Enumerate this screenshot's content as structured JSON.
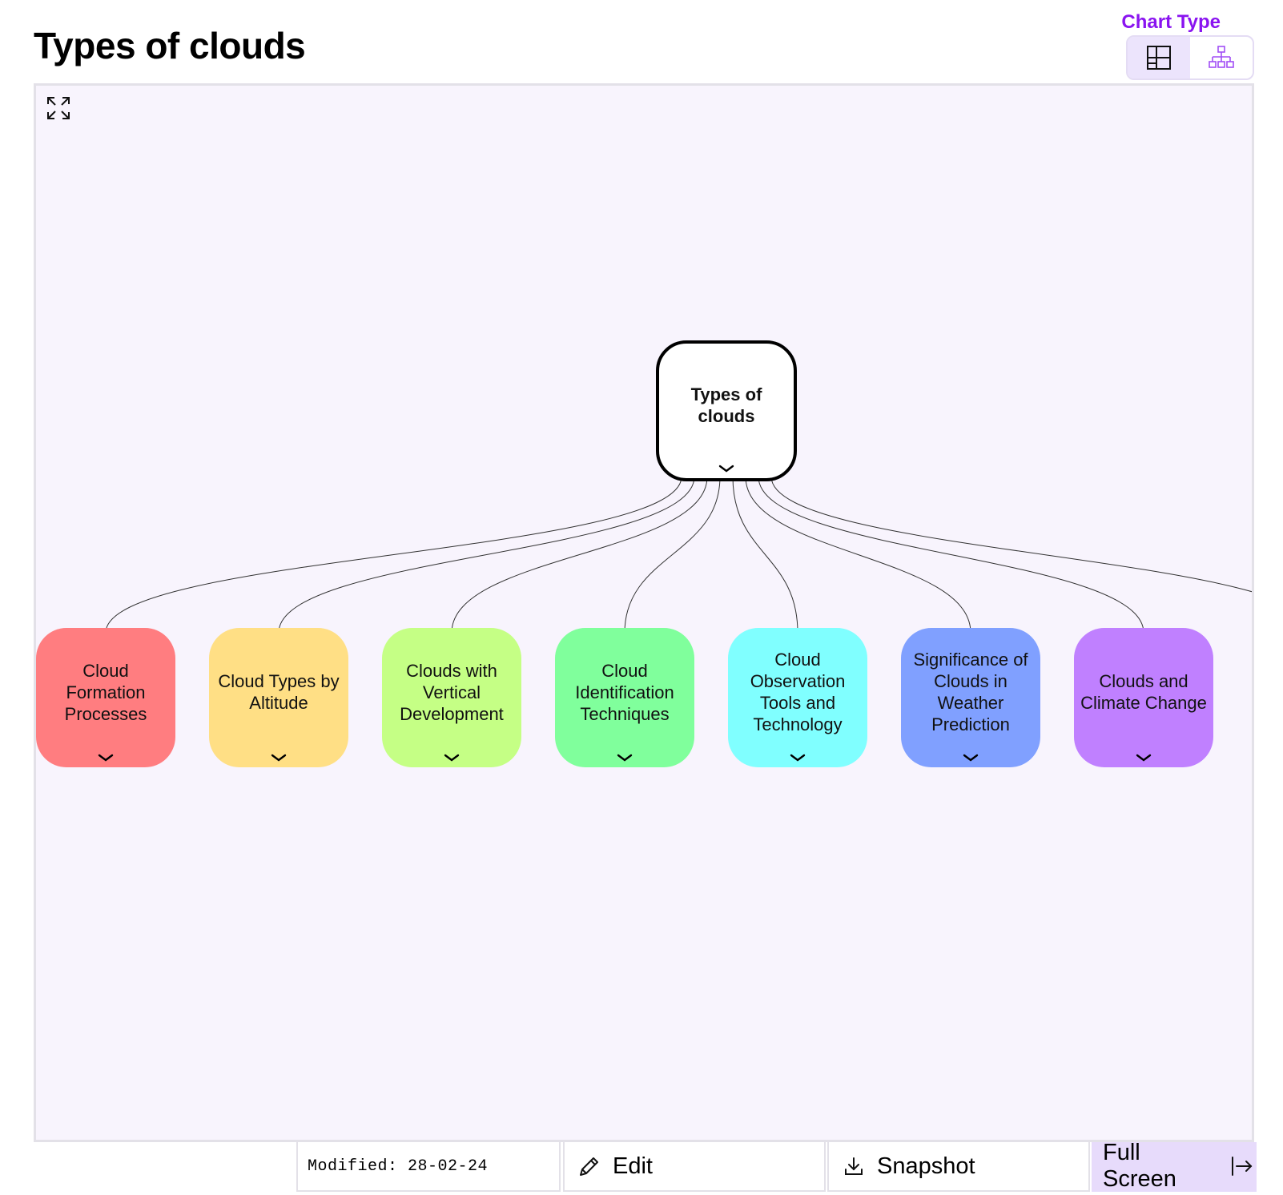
{
  "page": {
    "title": "Types of clouds"
  },
  "chart_type": {
    "label": "Chart Type",
    "options": [
      {
        "icon": "grid-layout-icon",
        "active": false
      },
      {
        "icon": "org-chart-icon",
        "active": true
      }
    ],
    "accent_color": "#8a14f0"
  },
  "diagram": {
    "root": {
      "label": "Types of clouds"
    },
    "children": [
      {
        "label": "Cloud Formation Processes",
        "color": "#ff7d80"
      },
      {
        "label": "Cloud Types by Altitude",
        "color": "#ffdf85"
      },
      {
        "label": "Clouds with Vertical Development",
        "color": "#c5ff85"
      },
      {
        "label": "Cloud Identification Techniques",
        "color": "#80ff9c"
      },
      {
        "label": "Cloud Observation Tools and Technology",
        "color": "#80ffff"
      },
      {
        "label": "Significance of Clouds in Weather Prediction",
        "color": "#80a0ff"
      },
      {
        "label": "Clouds and Climate Change",
        "color": "#c080ff"
      }
    ],
    "hidden_offscreen_children": 1
  },
  "footer": {
    "modified": "Modified: 28-02-24",
    "edit_label": "Edit",
    "snapshot_label": "Snapshot",
    "fullscreen_label": "Full Screen"
  }
}
